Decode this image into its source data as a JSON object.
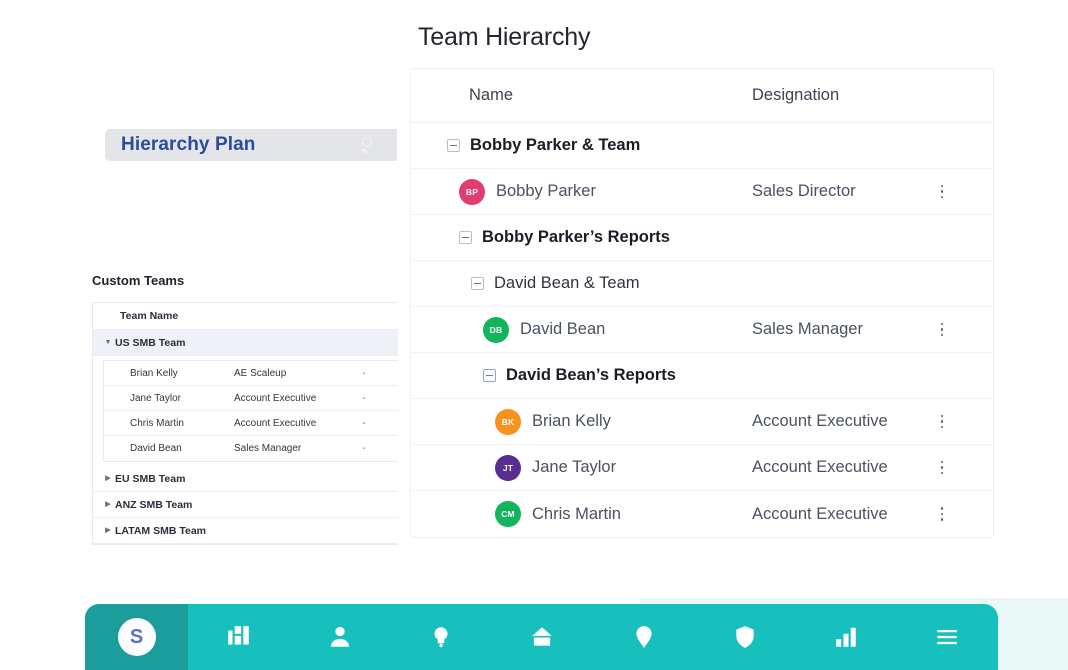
{
  "left_panel": {
    "plan_bar": {
      "title": "Hierarchy Plan",
      "search_icon": "search-icon"
    },
    "custom_teams_label": "Custom Teams",
    "teams_table": {
      "header": "Team Name",
      "teams": [
        {
          "name": "US SMB Team",
          "expanded": true,
          "members": [
            {
              "name": "Brian Kelly",
              "role": "AE Scaleup",
              "extra": "-"
            },
            {
              "name": "Jane Taylor",
              "role": "Account Executive",
              "extra": "-"
            },
            {
              "name": "Chris Martin",
              "role": "Account Executive",
              "extra": "-"
            },
            {
              "name": "David Bean",
              "role": "Sales Manager",
              "extra": "-"
            }
          ]
        },
        {
          "name": "EU SMB Team",
          "expanded": false,
          "members": []
        },
        {
          "name": "ANZ SMB Team",
          "expanded": false,
          "members": []
        },
        {
          "name": "LATAM SMB Team",
          "expanded": false,
          "members": []
        }
      ]
    }
  },
  "main": {
    "title": "Team Hierarchy",
    "columns": {
      "name": "Name",
      "designation": "Designation"
    },
    "rows": [
      {
        "type": "group",
        "label": "Bobby Parker & Team",
        "weight": "strong",
        "indent": 0,
        "expander": "minus"
      },
      {
        "type": "person",
        "name": "Bobby Parker",
        "designation": "Sales Director",
        "initials": "BP",
        "color": "#e23b6d",
        "indent": 1
      },
      {
        "type": "group",
        "label": "Bobby Parker’s Reports",
        "weight": "strong",
        "indent": 1,
        "expander": "minus"
      },
      {
        "type": "group",
        "label": "David Bean & Team",
        "weight": "light",
        "indent": 2,
        "expander": "minus"
      },
      {
        "type": "person",
        "name": "David Bean",
        "designation": "Sales Manager",
        "initials": "DB",
        "color": "#12b45c",
        "indent": 3
      },
      {
        "type": "group",
        "label": "David Bean’s Reports",
        "weight": "strong",
        "indent": 3,
        "expander": "minus-blue"
      },
      {
        "type": "person",
        "name": "Brian Kelly",
        "designation": "Account Executive",
        "initials": "BK",
        "color": "#f7921e",
        "indent": 4
      },
      {
        "type": "person",
        "name": "Jane Taylor",
        "designation": "Account Executive",
        "initials": "JT",
        "color": "#5b2d91",
        "indent": 4
      },
      {
        "type": "person",
        "name": "Chris Martin",
        "designation": "Account Executive",
        "initials": "CM",
        "color": "#12b45c",
        "indent": 4
      }
    ],
    "row_menu_icon": "kebab-menu-icon"
  },
  "toolbar": {
    "brand_initial": "S",
    "accent_color": "#17c0bd",
    "brand_bg_color": "#1a9d9b",
    "items": [
      {
        "icon": "dashboard-icon"
      },
      {
        "icon": "person-icon"
      },
      {
        "icon": "lightbulb-icon"
      },
      {
        "icon": "home-icon"
      },
      {
        "icon": "location-pin-icon"
      },
      {
        "icon": "shield-icon"
      },
      {
        "icon": "bar-chart-icon"
      },
      {
        "icon": "hamburger-menu-icon"
      }
    ]
  }
}
